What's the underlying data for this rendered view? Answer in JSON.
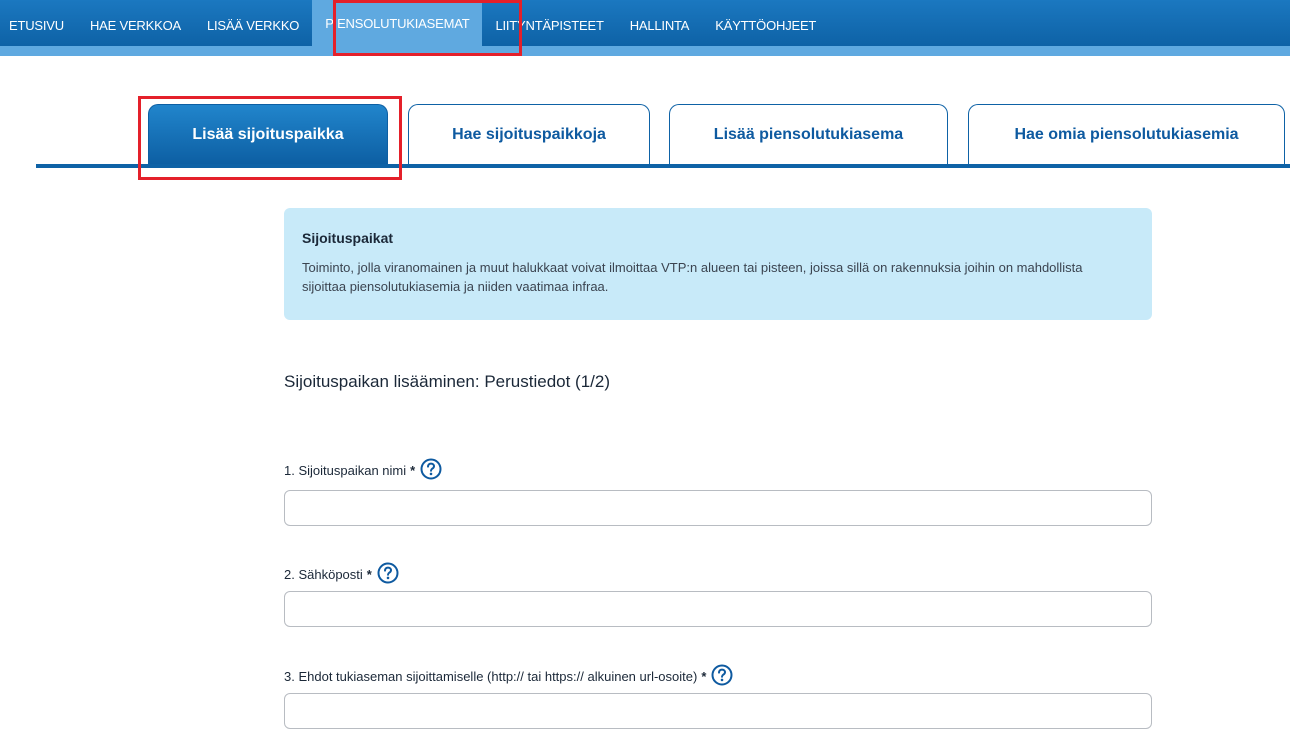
{
  "topnav": {
    "items": [
      {
        "label": "ETUSIVU"
      },
      {
        "label": "HAE VERKKOA"
      },
      {
        "label": "LISÄÄ VERKKO"
      },
      {
        "label": "PIENSOLUTUKIASEMAT"
      },
      {
        "label": "LIITYNTÄPISTEET"
      },
      {
        "label": "HALLINTA"
      },
      {
        "label": "KÄYTTÖOHJEET"
      }
    ],
    "active_index": 3
  },
  "tabs": [
    {
      "label": "Lisää sijoituspaikka"
    },
    {
      "label": "Hae sijoituspaikkoja"
    },
    {
      "label": "Lisää piensolutukiasema"
    },
    {
      "label": "Hae omia piensolutukiasemia"
    }
  ],
  "info": {
    "title": "Sijoituspaikat",
    "text": "Toiminto, jolla viranomainen ja muut halukkaat voivat ilmoittaa VTP:n alueen tai pisteen, joissa sillä on rakennuksia joihin on mahdollista sijoittaa piensolutukiasemia ja niiden vaatimaa infraa."
  },
  "form": {
    "heading": "Sijoituspaikan lisääminen: Perustiedot (1/2)",
    "fields": [
      {
        "label": "1. Sijoituspaikan nimi",
        "required": "*",
        "value": ""
      },
      {
        "label": "2. Sähköposti",
        "required": "*",
        "value": ""
      },
      {
        "label": "3. Ehdot tukiaseman sijoittamiselle (http:// tai https:// alkuinen url-osoite)",
        "required": "*",
        "value": ""
      }
    ]
  },
  "colors": {
    "nav_blue": "#0e62a6",
    "nav_active": "#5fa9e0",
    "info_bg": "#c8eaf9",
    "highlight_red": "#e4202a"
  },
  "icons": {
    "help": "question-circle-icon"
  }
}
